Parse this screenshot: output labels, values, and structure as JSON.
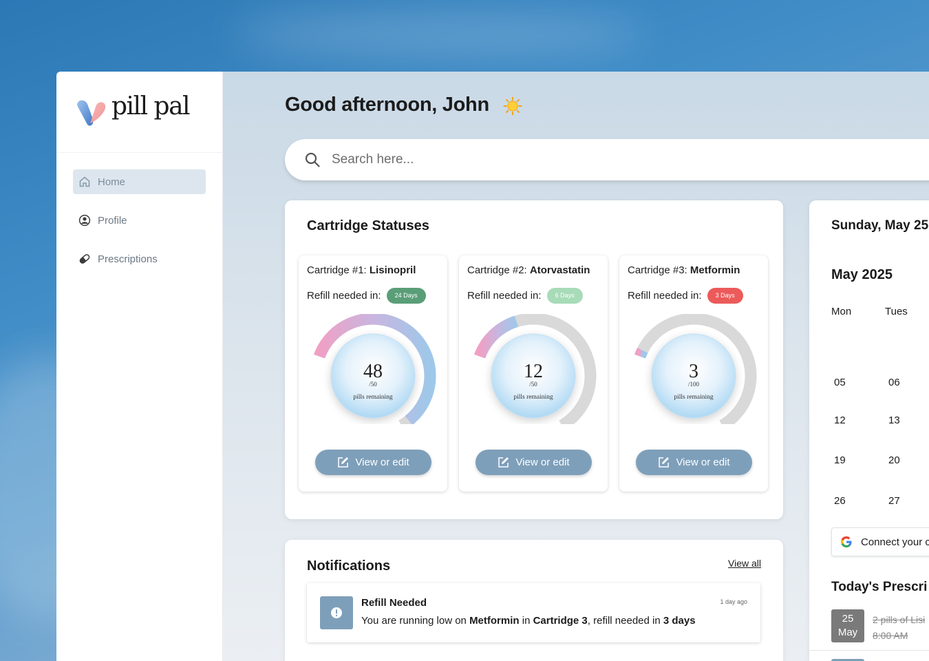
{
  "app": {
    "name": "pill pal"
  },
  "sidebar": {
    "items": [
      {
        "label": "Home",
        "icon": "home-icon",
        "active": true
      },
      {
        "label": "Profile",
        "icon": "profile-icon",
        "active": false
      },
      {
        "label": "Prescriptions",
        "icon": "pill-icon",
        "active": false
      }
    ]
  },
  "header": {
    "greeting": "Good afternoon, John",
    "greeting_icon": "sun-icon"
  },
  "search": {
    "placeholder": "Search here..."
  },
  "cartridges": {
    "title": "Cartridge Statuses",
    "refill_label": "Refill needed in:",
    "button_label": "View or edit",
    "items": [
      {
        "prefix": "Cartridge #1: ",
        "name": "Lisinopril",
        "refill": "24 Days",
        "badge_color": "#5a9e78",
        "count": "48",
        "total": "/50",
        "sub": "pills remaining",
        "fill_fraction": 0.96
      },
      {
        "prefix": "Cartridge #2: ",
        "name": "Atorvastatin",
        "refill": "6 Days",
        "badge_color": "#a8dbb8",
        "count": "12",
        "total": "/50",
        "sub": "pills remaining",
        "fill_fraction": 0.24
      },
      {
        "prefix": "Cartridge #3: ",
        "name": "Metformin",
        "refill": "3 Days",
        "badge_color": "#ec5a5a",
        "count": "3",
        "total": "/100",
        "sub": "pills remaining",
        "fill_fraction": 0.03
      }
    ]
  },
  "notifications": {
    "title": "Notifications",
    "view_all": "View all",
    "items": [
      {
        "heading": "Refill Needed",
        "time": "1 day ago",
        "body": {
          "p1": "You are running low on ",
          "b1": "Metformin",
          "p2": " in ",
          "b2": "Cartridge 3",
          "p3": ", refill needed in ",
          "b3": "3 days"
        }
      }
    ]
  },
  "calendar": {
    "current_date": "Sunday, May 25",
    "month": "May 2025",
    "weekdays": [
      "Mon",
      "Tues"
    ],
    "weeks": [
      [
        "05",
        "06"
      ],
      [
        "12",
        "13"
      ],
      [
        "19",
        "20"
      ],
      [
        "26",
        "27"
      ]
    ],
    "connect_label": "Connect your c",
    "today_title": "Today's Prescri",
    "today_items": [
      {
        "day": "25",
        "month": "May",
        "text": "2 pills of Lisi",
        "time": "8:00 AM",
        "done": true
      }
    ]
  },
  "colors": {
    "accent": "#7e9fba",
    "nav_active_bg": "#dde6ee"
  }
}
